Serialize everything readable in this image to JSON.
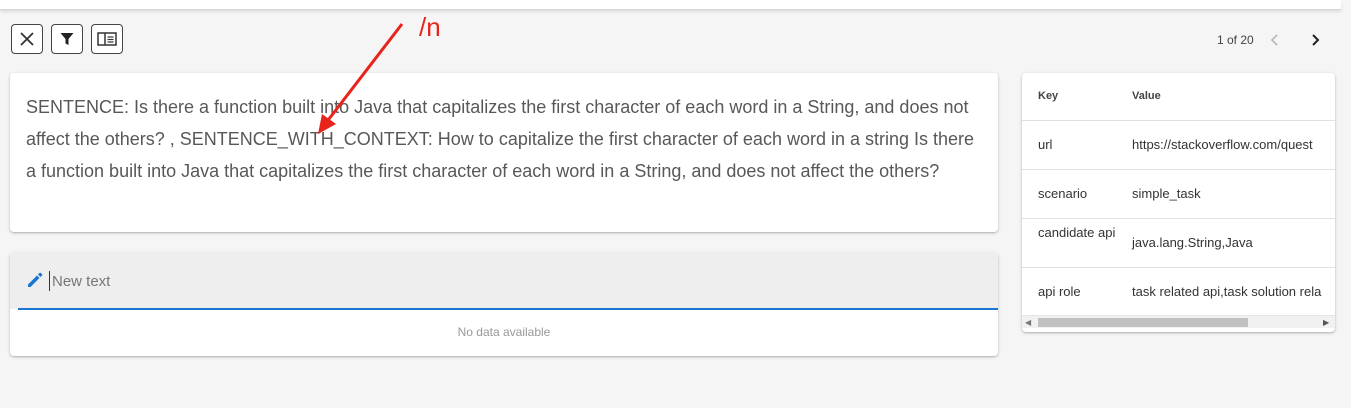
{
  "toolbar": {
    "buttons": [
      {
        "name": "close",
        "icon": "close-icon"
      },
      {
        "name": "filter",
        "icon": "filter-icon"
      },
      {
        "name": "panel",
        "icon": "side-panel-icon"
      }
    ]
  },
  "pager": {
    "text": "1 of 20",
    "prev_icon": "chevron-left-icon",
    "next_icon": "chevron-right-icon"
  },
  "sentence": {
    "text": "SENTENCE: Is there a function built into Java that capitalizes the first character of each word in a String, and does not affect the others? , SENTENCE_WITH_CONTEXT: How to capitalize the first character of each word in a string Is there a function built into Java that capitalizes the first character of each word in a String, and does not affect the others?"
  },
  "new_text": {
    "placeholder": "New text",
    "value": "",
    "icon": "pencil-icon",
    "empty_message": "No data available"
  },
  "kv_table": {
    "headers": {
      "key": "Key",
      "value": "Value"
    },
    "rows": [
      {
        "key": "url",
        "value": "https://stackoverflow.com/quest"
      },
      {
        "key": "scenario",
        "value": "simple_task"
      },
      {
        "key": "candidate api",
        "value": "java.lang.String,Java"
      },
      {
        "key": "api role",
        "value": "task related api,task solution rela"
      }
    ]
  },
  "annotation": {
    "text": "/n",
    "color": "#e8231c"
  },
  "colors": {
    "accent": "#1976d2",
    "background": "#f5f5f5",
    "annotation": "#e8231c"
  }
}
